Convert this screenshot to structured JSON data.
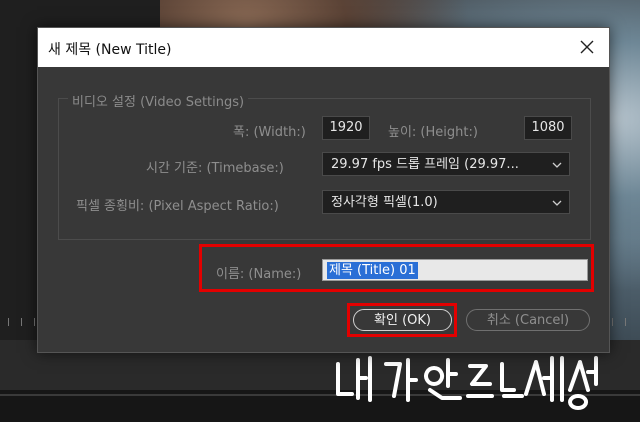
{
  "dialog": {
    "title": "새 제목 (New Title)",
    "close_icon": "close-icon"
  },
  "video_settings": {
    "legend": "비디오 설정 (Video Settings)",
    "width_label": "폭: (Width:)",
    "width_value": "1920",
    "height_label": "높이: (Height:)",
    "height_value": "1080",
    "timebase_label": "시간 기준: (Timebase:)",
    "timebase_value": "29.97 fps 드롭 프레임 (29.97...",
    "par_label": "픽셀 종횡비: (Pixel Aspect Ratio:)",
    "par_value": "정사각형 픽셀(1.0)"
  },
  "name": {
    "label": "이름: (Name:)",
    "value": "제목 (Title) 01"
  },
  "buttons": {
    "ok": "확인 (OK)",
    "cancel": "취소 (Cancel)"
  },
  "colors": {
    "annotation": "#e30000",
    "selection": "#2a6fd6"
  }
}
